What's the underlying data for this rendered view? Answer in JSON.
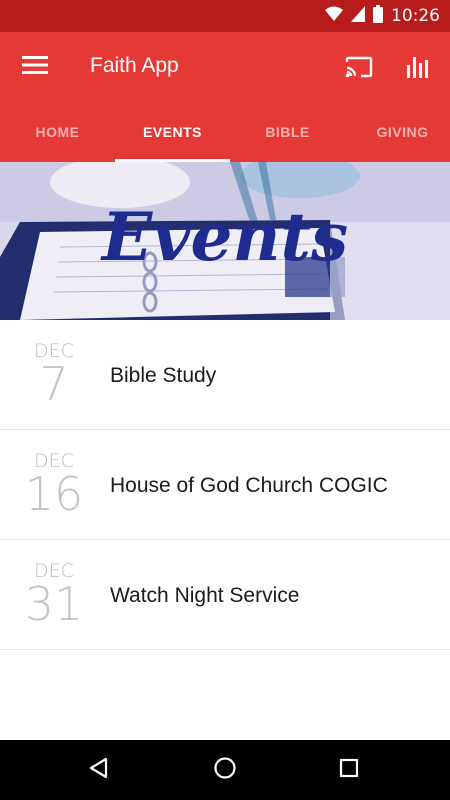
{
  "status_bar": {
    "time": "10:26",
    "icons": [
      "wifi-icon",
      "signal-icon",
      "battery-icon"
    ]
  },
  "app_bar": {
    "title": "Faith App",
    "menu_icon": "hamburger-menu-icon",
    "actions": [
      "cast-icon",
      "bar-chart-icon"
    ],
    "color": "#e53935"
  },
  "tabs": [
    {
      "label": "HOME",
      "active": false
    },
    {
      "label": "EVENTS",
      "active": true
    },
    {
      "label": "BIBLE",
      "active": false
    },
    {
      "label": "GIVING",
      "active": false
    }
  ],
  "banner": {
    "heading": "Events",
    "heading_color": "#1f2c8f"
  },
  "events": [
    {
      "month": "DEC",
      "day": "7",
      "title": "Bible Study"
    },
    {
      "month": "DEC",
      "day": "16",
      "title": "House of God Church COGIC"
    },
    {
      "month": "DEC",
      "day": "31",
      "title": "Watch Night Service"
    }
  ],
  "nav_bar": {
    "buttons": [
      "back-icon",
      "home-icon",
      "recents-icon"
    ]
  }
}
